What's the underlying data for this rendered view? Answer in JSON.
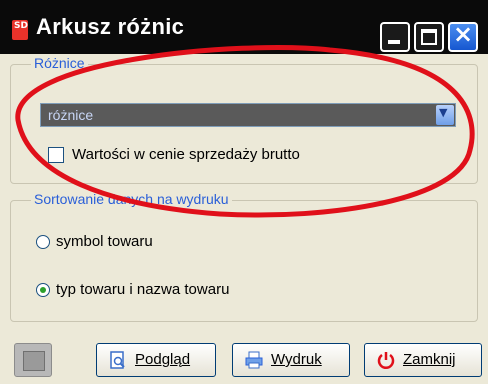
{
  "window": {
    "title": "Arkusz różnic",
    "logo_text": "SD"
  },
  "titlebar_buttons": {
    "minimize": "minimize",
    "maximize": "maximize",
    "close": "×"
  },
  "group_differences": {
    "legend": "Różnice",
    "combo_value": "różnice",
    "checkbox_label": "Wartości w cenie sprzedaży brutto",
    "checkbox_checked": false
  },
  "group_sort": {
    "legend": "Sortowanie danych na wydruku",
    "options": [
      {
        "label": "symbol towaru",
        "selected": false
      },
      {
        "label": "typ towaru i nazwa towaru",
        "selected": true
      }
    ]
  },
  "buttons": {
    "preview": "Podgląd",
    "print": "Wydruk",
    "close": "Zamknij"
  },
  "annotation": {
    "color": "#e0101a",
    "shape": "ellipse"
  }
}
